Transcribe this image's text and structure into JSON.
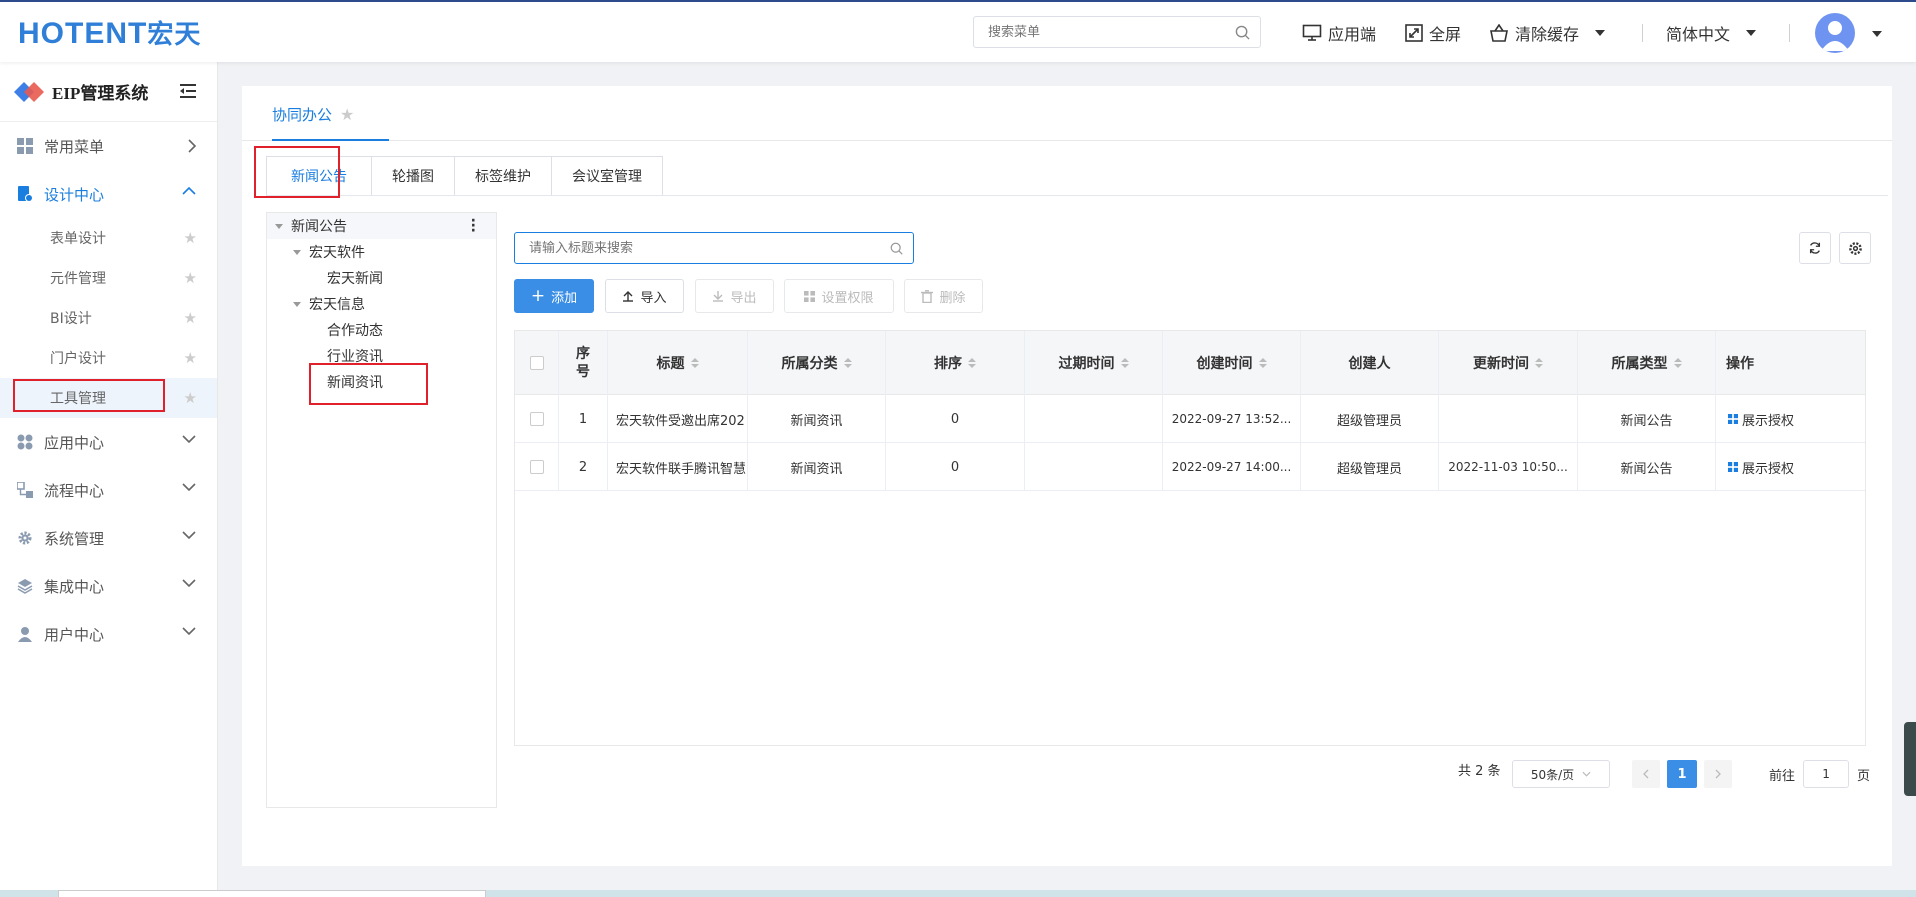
{
  "header": {
    "logo_main": "HOTENT",
    "logo_cn": "宏天",
    "search_placeholder": "搜索菜单",
    "tools": {
      "app_end": "应用端",
      "fullscreen": "全屏",
      "clear_cache": "清除缓存",
      "language": "简体中文"
    }
  },
  "sidebar": {
    "system_title": "EIP管理系统",
    "menus": [
      {
        "label": "常用菜单",
        "icon": "grid-icon"
      },
      {
        "label": "设计中心",
        "icon": "design-icon"
      },
      {
        "label": "应用中心",
        "icon": "apps-icon"
      },
      {
        "label": "流程中心",
        "icon": "flow-icon"
      },
      {
        "label": "系统管理",
        "icon": "gear-icon"
      },
      {
        "label": "集成中心",
        "icon": "layers-icon"
      },
      {
        "label": "用户中心",
        "icon": "user-icon"
      }
    ],
    "design_sub": [
      "表单设计",
      "元件管理",
      "BI设计",
      "门户设计",
      "工具管理"
    ]
  },
  "page": {
    "tab_title": "协同办公",
    "sub_tabs": [
      "新闻公告",
      "轮播图",
      "标签维护",
      "会议室管理"
    ]
  },
  "tree": {
    "root": "新闻公告",
    "nodes": [
      "宏天软件",
      "宏天新闻",
      "宏天信息",
      "合作动态",
      "行业资讯",
      "新闻资讯"
    ]
  },
  "toolbar": {
    "search_placeholder": "请输入标题来搜索",
    "add": "添加",
    "import": "导入",
    "export": "导出",
    "permission": "设置权限",
    "delete": "删除"
  },
  "table": {
    "columns": [
      "序\n号",
      "标题",
      "所属分类",
      "排序",
      "过期时间",
      "创建时间",
      "创建人",
      "更新时间",
      "所属类型",
      "操作"
    ],
    "rows": [
      {
        "no": "1",
        "title": "宏天软件受邀出席202",
        "category": "新闻资讯",
        "sort": "0",
        "expire": "",
        "created": "2022-09-27 13:52...",
        "creator": "超级管理员",
        "updated": "",
        "type": "新闻公告",
        "action": "展示授权"
      },
      {
        "no": "2",
        "title": "宏天软件联手腾讯智慧",
        "category": "新闻资讯",
        "sort": "0",
        "expire": "",
        "created": "2022-09-27 14:00...",
        "creator": "超级管理员",
        "updated": "2022-11-03 10:50...",
        "type": "新闻公告",
        "action": "展示授权"
      }
    ]
  },
  "pager": {
    "total": "共 2 条",
    "page_size": "50条/页",
    "current": "1",
    "goto_prefix": "前往",
    "goto_value": "1",
    "goto_suffix": "页"
  },
  "colors": {
    "accent": "#1a7ee0",
    "highlight_box": "#e0202a"
  }
}
